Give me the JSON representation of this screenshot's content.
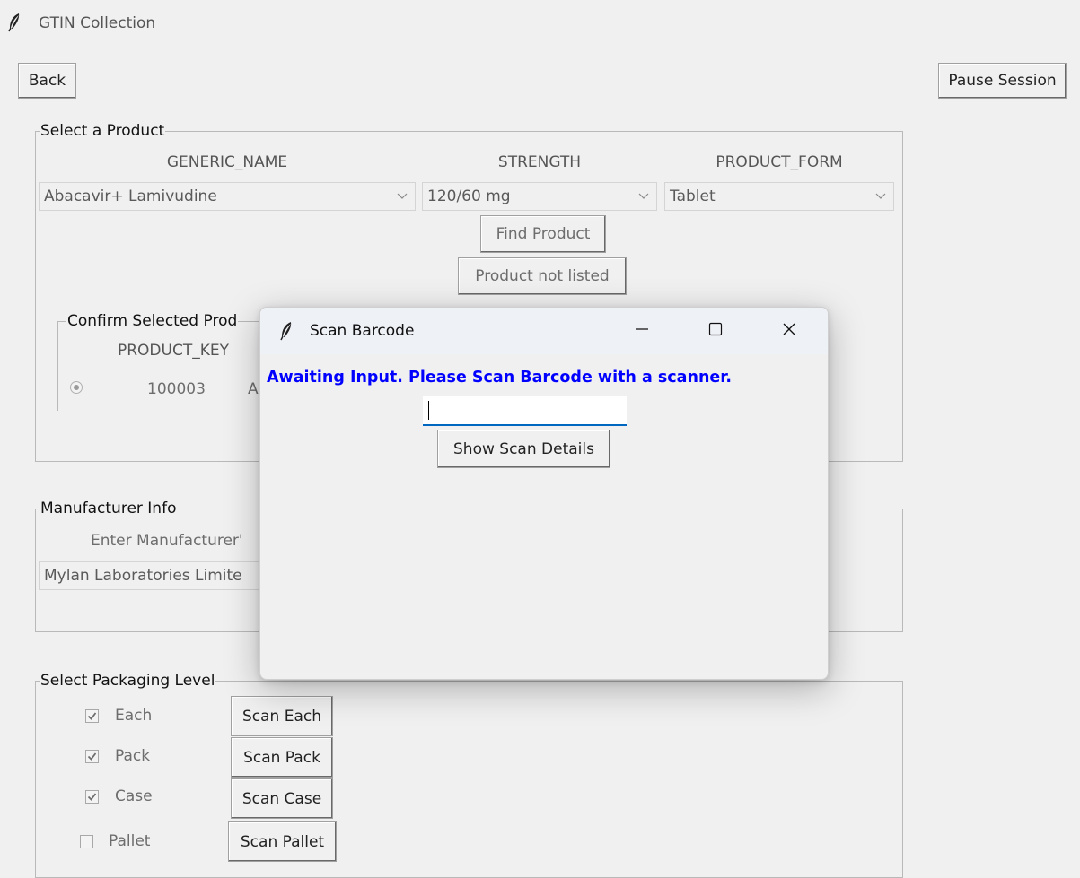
{
  "window": {
    "title": "GTIN Collection",
    "icon": "feather-icon"
  },
  "toolbar": {
    "back_label": "Back",
    "pause_label": "Pause Session"
  },
  "select_product": {
    "legend": "Select a Product",
    "headers": {
      "generic_name": "GENERIC_NAME",
      "strength": "STRENGTH",
      "product_form": "PRODUCT_FORM"
    },
    "generic_name_value": "Abacavir+ Lamivudine",
    "strength_value": "120/60 mg",
    "product_form_value": "Tablet",
    "find_label": "Find Product",
    "not_listed_label": "Product not listed"
  },
  "confirm_product": {
    "legend": "Confirm Selected Prod",
    "header_key": "PRODUCT_KEY",
    "row_key": "100003",
    "row_next": "A"
  },
  "manufacturer": {
    "legend": "Manufacturer Info",
    "prompt": "Enter Manufacturer'",
    "value": "Mylan Laboratories Limite"
  },
  "packaging": {
    "legend": "Select Packaging Level",
    "levels": [
      {
        "label": "Each",
        "checked": true,
        "button": "Scan Each"
      },
      {
        "label": "Pack",
        "checked": true,
        "button": "Scan Pack"
      },
      {
        "label": "Case",
        "checked": true,
        "button": "Scan Case"
      },
      {
        "label": "Pallet",
        "checked": false,
        "button": "Scan Pallet"
      }
    ]
  },
  "dialog": {
    "title": "Scan Barcode",
    "icon": "feather-icon",
    "message": "Awaiting Input. Please Scan Barcode with a scanner.",
    "input_value": "",
    "show_details_label": "Show Scan Details",
    "message_color": "#0000ff"
  }
}
